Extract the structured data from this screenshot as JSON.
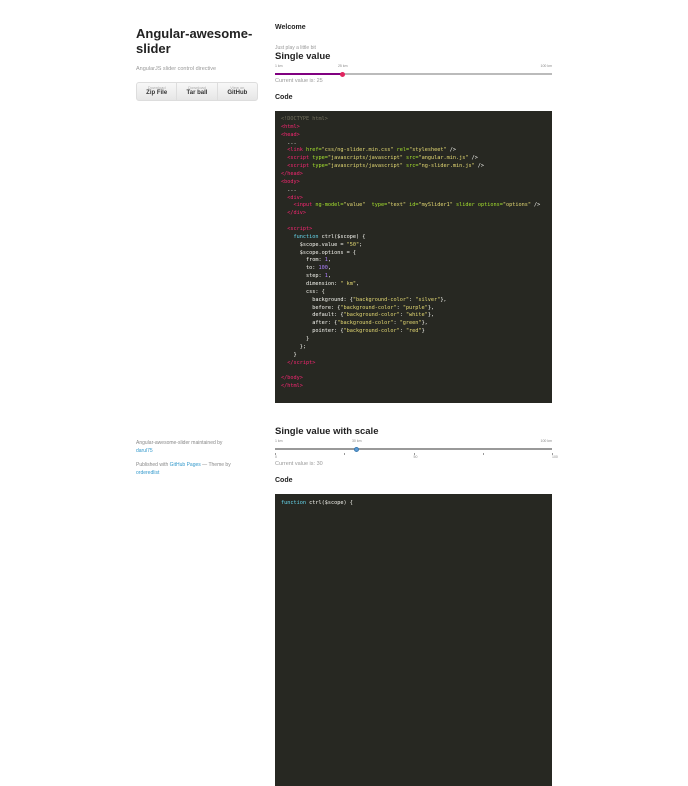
{
  "sidebar": {
    "title": "Angular-awesome-slider",
    "description": "AngularJS slider control directive",
    "buttons": [
      {
        "small": "Download",
        "big": "Zip File"
      },
      {
        "small": "Download",
        "big": "Tar ball"
      },
      {
        "small": "View on",
        "big": "GitHub"
      }
    ],
    "footer": {
      "maintained": "Angular-awesome-slider maintained by",
      "author": "darul75",
      "published": "Published with",
      "pages": "GitHub Pages",
      "theme": " — Theme by",
      "theme_author": "orderedlist"
    }
  },
  "main": {
    "welcome": "Welcome",
    "play": "Just play a little bit",
    "single": {
      "title": "Single value",
      "min_label": "1 km",
      "value_label": "25 km",
      "max_label": "100 km",
      "value": 25,
      "min": 1,
      "max": 100,
      "current": "Current value is: 25",
      "before_color": "#800080",
      "pointer_color": "#e0245e"
    },
    "code_title": "Code",
    "code": [
      [
        [
          "c",
          "<!DOCTYPE html>"
        ]
      ],
      [
        [
          "t",
          "<html>"
        ]
      ],
      [
        [
          "t",
          "<head>"
        ]
      ],
      [
        [
          "",
          "  ..."
        ]
      ],
      [
        [
          "",
          "  "
        ],
        [
          "t",
          "<link"
        ],
        [
          "a",
          " href="
        ],
        [
          "s",
          "\"css/ng-slider.min.css\""
        ],
        [
          "a",
          " rel="
        ],
        [
          "s",
          "\"stylesheet\""
        ],
        [
          "",
          " />"
        ]
      ],
      [
        [
          "",
          "  "
        ],
        [
          "t",
          "<script"
        ],
        [
          "a",
          " type="
        ],
        [
          "s",
          "\"javascripts/javascript\""
        ],
        [
          "a",
          " src="
        ],
        [
          "s",
          "\"angular.min.js\""
        ],
        [
          "",
          " />"
        ]
      ],
      [
        [
          "",
          "  "
        ],
        [
          "t",
          "<script"
        ],
        [
          "a",
          " type="
        ],
        [
          "s",
          "\"javascripts/javascript\""
        ],
        [
          "a",
          " src="
        ],
        [
          "s",
          "\"ng-slider.min.js\""
        ],
        [
          "",
          " />"
        ]
      ],
      [
        [
          "t",
          "</head>"
        ]
      ],
      [
        [
          "t",
          "<body>"
        ]
      ],
      [
        [
          "",
          "  ..."
        ]
      ],
      [
        [
          "",
          "  "
        ],
        [
          "t",
          "<div>"
        ]
      ],
      [
        [
          "",
          "    "
        ],
        [
          "t",
          "<input"
        ],
        [
          "a",
          " ng-model="
        ],
        [
          "s",
          "\"value\""
        ],
        [
          "a",
          "  type="
        ],
        [
          "s",
          "\"text\""
        ],
        [
          "a",
          " id="
        ],
        [
          "s",
          "\"mySlider1\""
        ],
        [
          "a",
          " slider options="
        ],
        [
          "s",
          "\"options\""
        ],
        [
          "",
          " />"
        ]
      ],
      [
        [
          "",
          "  "
        ],
        [
          "t",
          "</div>"
        ]
      ],
      [
        [
          "",
          ""
        ]
      ],
      [
        [
          "",
          "  "
        ],
        [
          "t",
          "<script>"
        ]
      ],
      [
        [
          "",
          "    "
        ],
        [
          "k",
          "function"
        ],
        [
          "",
          " ctrl($scope) {"
        ]
      ],
      [
        [
          "",
          "      $scope.value = "
        ],
        [
          "s",
          "\"50\""
        ],
        [
          "",
          ";"
        ]
      ],
      [
        [
          "",
          "      $scope.options = {"
        ]
      ],
      [
        [
          "",
          "        from: "
        ],
        [
          "n",
          "1"
        ],
        [
          "",
          ","
        ]
      ],
      [
        [
          "",
          "        to: "
        ],
        [
          "n",
          "100"
        ],
        [
          "",
          ","
        ]
      ],
      [
        [
          "",
          "        step: "
        ],
        [
          "n",
          "1"
        ],
        [
          "",
          ","
        ]
      ],
      [
        [
          "",
          "        dimension: "
        ],
        [
          "s",
          "\" km\""
        ],
        [
          "",
          ","
        ]
      ],
      [
        [
          "",
          "        css: {"
        ]
      ],
      [
        [
          "",
          "          background: {"
        ],
        [
          "s",
          "\"background-color\""
        ],
        [
          "",
          ": "
        ],
        [
          "s",
          "\"silver\""
        ],
        [
          "",
          "},"
        ]
      ],
      [
        [
          "",
          "          before: {"
        ],
        [
          "s",
          "\"background-color\""
        ],
        [
          "",
          ": "
        ],
        [
          "s",
          "\"purple\""
        ],
        [
          "",
          "},"
        ]
      ],
      [
        [
          "",
          "          default: {"
        ],
        [
          "s",
          "\"background-color\""
        ],
        [
          "",
          ": "
        ],
        [
          "s",
          "\"white\""
        ],
        [
          "",
          "},"
        ]
      ],
      [
        [
          "",
          "          after: {"
        ],
        [
          "s",
          "\"background-color\""
        ],
        [
          "",
          ": "
        ],
        [
          "s",
          "\"green\""
        ],
        [
          "",
          "},"
        ]
      ],
      [
        [
          "",
          "          pointer: {"
        ],
        [
          "s",
          "\"background-color\""
        ],
        [
          "",
          ": "
        ],
        [
          "s",
          "\"red\""
        ],
        [
          "",
          "}"
        ]
      ],
      [
        [
          "",
          "        }"
        ]
      ],
      [
        [
          "",
          "      };"
        ]
      ],
      [
        [
          "",
          "    }"
        ]
      ],
      [
        [
          "",
          "  "
        ],
        [
          "t",
          "</script>"
        ]
      ],
      [
        [
          "",
          ""
        ]
      ],
      [
        [
          "t",
          "</body>"
        ]
      ],
      [
        [
          "t",
          "</html>"
        ]
      ]
    ],
    "scale": {
      "title": "Single value with scale",
      "min_label": "1 km",
      "value_label": "30 km",
      "max_label": "100 km",
      "value": 30,
      "min": 1,
      "max": 100,
      "ticks": [
        "0",
        "",
        "50",
        "",
        "100"
      ],
      "current": "Current value is: 30",
      "pointer_color": "#5b9bd5"
    },
    "code2_first": "function ctrl($scope) {"
  }
}
